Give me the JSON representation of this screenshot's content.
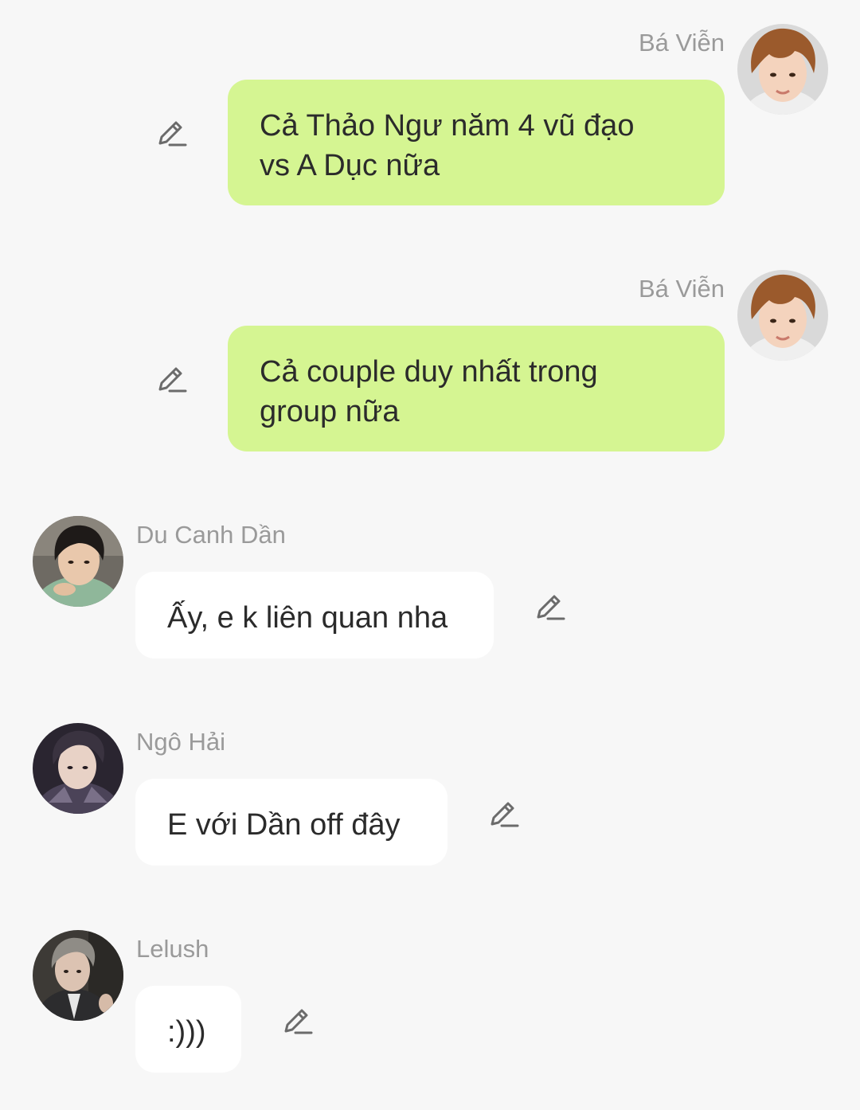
{
  "messages": [
    {
      "sender": "Bá Viễn",
      "direction": "outgoing",
      "avatar_icon": "avatar-ba-vien",
      "lines": [
        "Cả Thảo Ngư năm 4 vũ đạo",
        "vs A Dục nữa"
      ],
      "action_icon": "edit-pencil-icon"
    },
    {
      "sender": "Bá Viễn",
      "direction": "outgoing",
      "avatar_icon": "avatar-ba-vien",
      "lines": [
        "Cả couple duy nhất trong",
        "group nữa"
      ],
      "action_icon": "edit-pencil-icon"
    },
    {
      "sender": "Du Canh Dần",
      "direction": "incoming",
      "avatar_icon": "avatar-du-canh-dan",
      "lines": [
        "Ấy, e k liên quan nha"
      ],
      "action_icon": "edit-pencil-icon"
    },
    {
      "sender": "Ngô Hải",
      "direction": "incoming",
      "avatar_icon": "avatar-ngo-hai",
      "lines": [
        "E với Dần off đây"
      ],
      "action_icon": "edit-pencil-icon"
    },
    {
      "sender": "Lelush",
      "direction": "incoming",
      "avatar_icon": "avatar-lelush",
      "lines": [
        ":)))"
      ],
      "action_icon": "edit-pencil-icon"
    }
  ],
  "colors": {
    "background": "#f7f7f7",
    "outgoing_bubble": "#d5f592",
    "incoming_bubble": "#ffffff",
    "sender_name": "#9a9a9a",
    "message_text": "#2b2b2b",
    "icon": "#6b6b6b"
  }
}
